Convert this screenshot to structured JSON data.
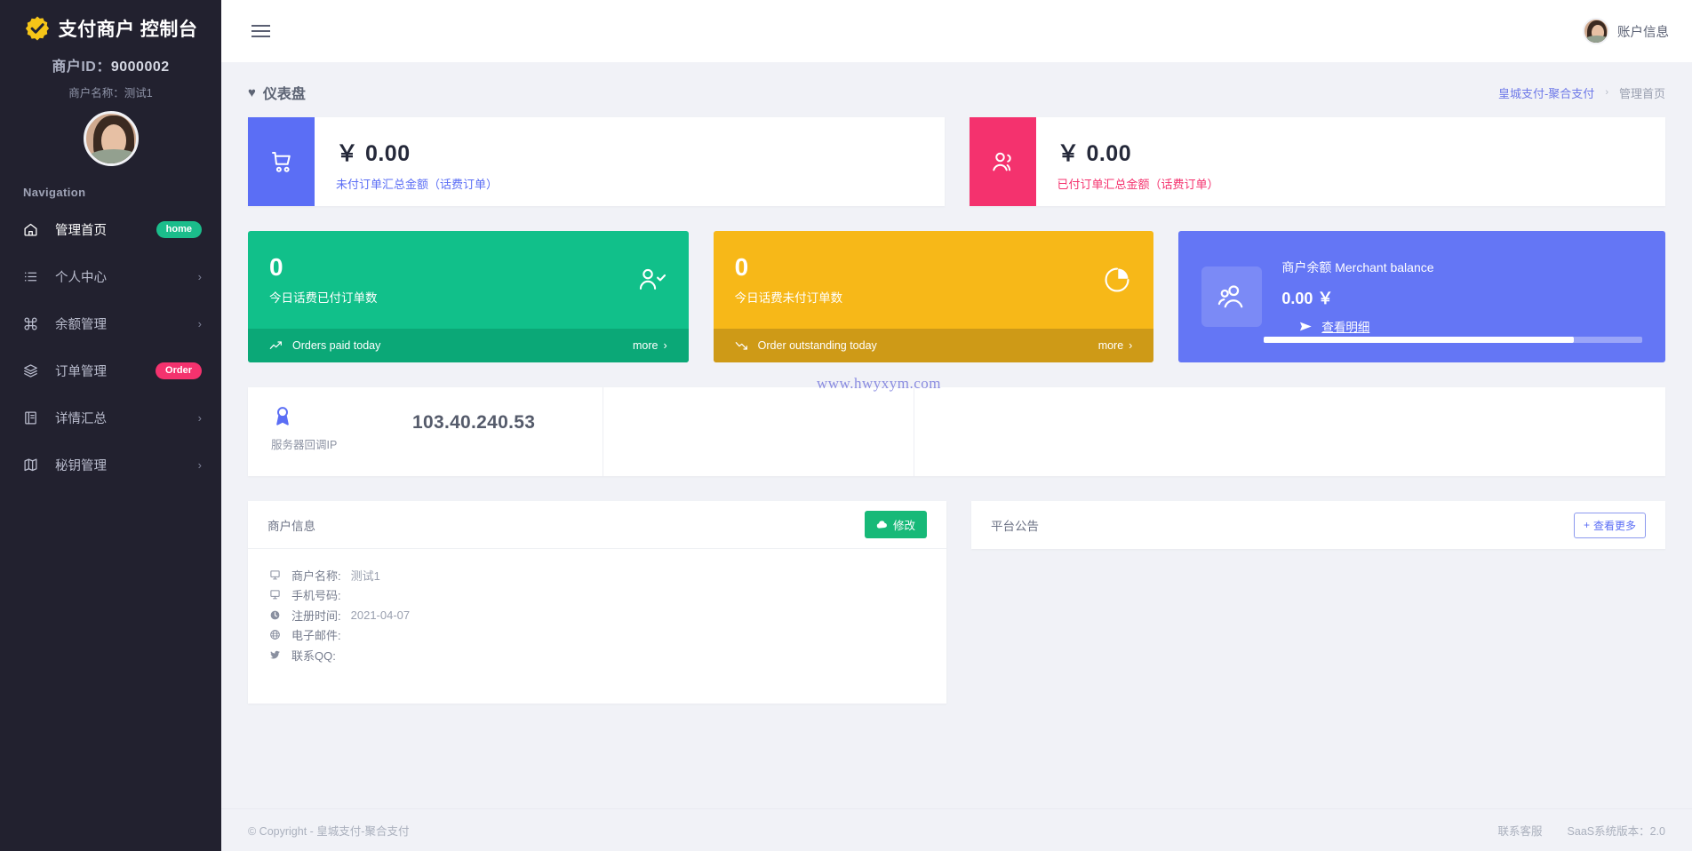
{
  "sidebar": {
    "brand": "支付商户 控制台",
    "logo_icon": "badge-check-icon",
    "merchant_id_label": "商户ID：",
    "merchant_id_value": "9000002",
    "merchant_name_line": "商户名称：测试1",
    "nav_label": "Navigation",
    "items": [
      {
        "label": "管理首页",
        "icon": "home-icon",
        "badge": "home",
        "badge_color": "#1bbd8b",
        "chevron": false,
        "active": true
      },
      {
        "label": "个人中心",
        "icon": "list-icon",
        "badge": "",
        "chevron": true,
        "active": false
      },
      {
        "label": "余额管理",
        "icon": "command-icon",
        "badge": "",
        "chevron": true,
        "active": false
      },
      {
        "label": "订单管理",
        "icon": "layers-icon",
        "badge": "Order",
        "badge_color": "#f4326e",
        "chevron": false,
        "active": false
      },
      {
        "label": "详情汇总",
        "icon": "book-icon",
        "badge": "",
        "chevron": true,
        "active": false
      },
      {
        "label": "秘钥管理",
        "icon": "map-icon",
        "badge": "",
        "chevron": true,
        "active": false
      }
    ]
  },
  "topbar": {
    "menu_icon": "hamburger-icon",
    "account_label": "账户信息",
    "avatar_icon": "user-avatar"
  },
  "page": {
    "title": "仪表盘",
    "title_icon": "heart-icon",
    "breadcrumb_link": "皇城支付-聚合支付",
    "breadcrumb_sep": "›",
    "breadcrumb_current": "管理首页"
  },
  "amount_cards": [
    {
      "icon": "shopping-cart-icon",
      "value": "￥ 0.00",
      "label": "未付订单汇总金额（话费订单）",
      "color": "#5b6ef5"
    },
    {
      "icon": "users-icon",
      "value": "￥ 0.00",
      "label": "已付订单汇总金额（话费订单）",
      "color": "#f4326e"
    }
  ],
  "stat_cards": [
    {
      "number": "0",
      "desc": "今日话费已付订单数",
      "icon": "user-check-icon",
      "footer_icon": "trend-up-icon",
      "footer_label": "Orders paid today",
      "more": "more",
      "more_chevron": "›",
      "color": "#11c08a",
      "footer_color": "#0ba877"
    },
    {
      "number": "0",
      "desc": "今日话费未付订单数",
      "icon": "pie-chart-icon",
      "footer_icon": "trend-down-icon",
      "footer_label": "Order outstanding today",
      "more": "more",
      "more_chevron": "›",
      "color": "#f7b818",
      "footer_color": "#ce9a17"
    }
  ],
  "balance_card": {
    "icon": "group-users-icon",
    "title": "商户余额 Merchant balance",
    "amount": "0.00 ￥",
    "link_icon": "send-icon",
    "link_label": "查看明细",
    "progress_percent": 82,
    "color": "#6476f5"
  },
  "server_ip": {
    "icon": "award-icon",
    "value": "103.40.240.53",
    "caption": "服务器回调IP",
    "watermark": "www.hwyxym.com"
  },
  "merchant_panel": {
    "title": "商户信息",
    "button_icon": "cloud-icon",
    "button_label": "修改",
    "rows": [
      {
        "icon": "monitor-icon",
        "label": "商户名称:",
        "value": "测试1"
      },
      {
        "icon": "monitor-icon",
        "label": "手机号码:",
        "value": ""
      },
      {
        "icon": "clock-icon",
        "label": "注册时间:",
        "value": "2021-04-07"
      },
      {
        "icon": "globe-icon",
        "label": "电子邮件:",
        "value": ""
      },
      {
        "icon": "twitter-icon",
        "label": "联系QQ:",
        "value": ""
      }
    ]
  },
  "notice_panel": {
    "title": "平台公告",
    "button_icon": "plus-icon",
    "button_label": "查看更多"
  },
  "footer": {
    "copyright": "© Copyright - 皇城支付-聚合支付",
    "support": "联系客服",
    "version": "SaaS系统版本：2.0"
  }
}
